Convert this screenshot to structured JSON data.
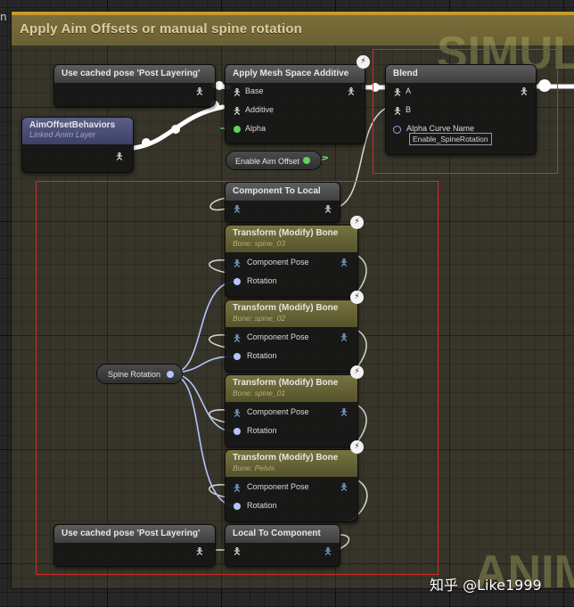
{
  "comment": {
    "title": "Apply Aim Offsets or manual spine rotation"
  },
  "corner_mark": "n",
  "watermarks": {
    "top_right": "SIMUL",
    "bottom_right": "ANIM"
  },
  "footer_watermark": "知乎 @Like1999",
  "nodes": {
    "cached_pose_top": {
      "title": "Use cached pose 'Post Layering'"
    },
    "cached_pose_bottom": {
      "title": "Use cached pose 'Post Layering'"
    },
    "aim_offset_behaviors": {
      "title": "AimOffsetBehaviors",
      "subtitle": "Linked Anim Layer"
    },
    "apply_additive": {
      "title": "Apply Mesh Space Additive",
      "pins": [
        "Base",
        "Additive",
        "Alpha"
      ]
    },
    "enable_aim_offset": {
      "label": "Enable Aim Offset"
    },
    "blend": {
      "title": "Blend",
      "pins": [
        "A",
        "B"
      ],
      "curve_label": "Alpha Curve Name",
      "curve_value": "Enable_SpineRotation"
    },
    "component_to_local": {
      "title": "Component To Local"
    },
    "local_to_component": {
      "title": "Local To Component"
    },
    "spine_rotation": {
      "label": "Spine Rotation"
    },
    "transform_bones": [
      {
        "title": "Transform (Modify) Bone",
        "bone": "Bone: spine_03",
        "pin_pose": "Component Pose",
        "pin_rot": "Rotation"
      },
      {
        "title": "Transform (Modify) Bone",
        "bone": "Bone: spine_02",
        "pin_pose": "Component Pose",
        "pin_rot": "Rotation"
      },
      {
        "title": "Transform (Modify) Bone",
        "bone": "Bone: spine_01",
        "pin_pose": "Component Pose",
        "pin_rot": "Rotation"
      },
      {
        "title": "Transform (Modify) Bone",
        "bone": "Bone: Pelvis",
        "pin_pose": "Component Pose",
        "pin_rot": "Rotation"
      }
    ]
  },
  "icons": {
    "pose": "pose-figure-icon",
    "bolt": "fast-path-bolt-icon"
  },
  "colors": {
    "comment_accent": "#c79b2a",
    "selection": "#d12a2a",
    "exec_wire": "#ffffff",
    "rotation_wire": "#b5c3ff",
    "bool_wire": "#5fd35f"
  }
}
